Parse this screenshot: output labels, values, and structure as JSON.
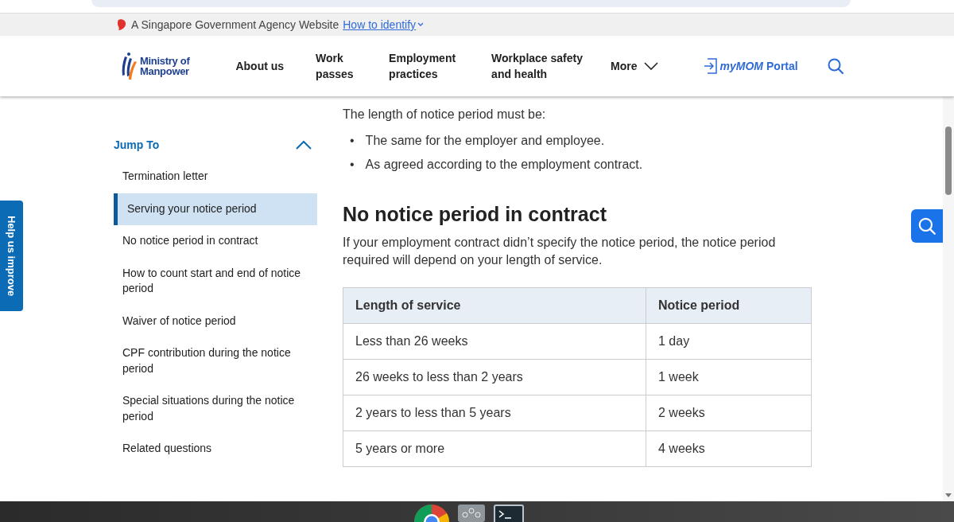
{
  "masthead": {
    "text": "A Singapore Government Agency Website",
    "link": "How to identify"
  },
  "header": {
    "logo": {
      "line_1": "Ministry of",
      "line_2": "Manpower"
    },
    "nav": [
      {
        "label": "About us",
        "kind": "link"
      },
      {
        "label": "Work passes",
        "kind": "link"
      },
      {
        "label": "Employment practices",
        "kind": "link"
      },
      {
        "label": "Workplace safety and health",
        "kind": "link"
      },
      {
        "label": "More",
        "kind": "dropdown"
      }
    ],
    "portal": {
      "brand": "myMOM",
      "label": "Portal"
    }
  },
  "feedback_tab": "Help us improve",
  "sidebar": {
    "title": "Jump To",
    "expanded": true,
    "items": [
      {
        "label": "Termination letter",
        "selected": false
      },
      {
        "label": "Serving your notice period",
        "selected": true
      },
      {
        "label": "No notice period in contract",
        "selected": false
      },
      {
        "label": "How to count start and end of notice period",
        "selected": false
      },
      {
        "label": "Waiver of notice period",
        "selected": false
      },
      {
        "label": "CPF contribution during the notice period",
        "selected": false
      },
      {
        "label": "Special situations during the notice period",
        "selected": false
      },
      {
        "label": "Related questions",
        "selected": false
      }
    ]
  },
  "article": {
    "intro": "The length of notice period must be:",
    "bullets": [
      {
        "marker": "•",
        "text": "The same for the employer and employee."
      },
      {
        "marker": "•",
        "text": "As agreed according to the employment contract."
      }
    ],
    "heading": "No notice period in contract",
    "paragraph": "If your employment contract didn’t specify the notice period, the notice period required will depend on your length of service.",
    "table": {
      "columns": [
        "Length of service",
        "Notice period"
      ],
      "rows": [
        [
          "Less than 26 weeks",
          "1 day"
        ],
        [
          "26 weeks to less than 2 years",
          "1 week"
        ],
        [
          "2 years to less than 5 years",
          "2 weeks"
        ],
        [
          "5 years or more",
          "4 weeks"
        ]
      ]
    }
  },
  "taskbar": {
    "apps": [
      {
        "kind": "browser"
      },
      {
        "kind": "network"
      },
      {
        "kind": "terminal"
      }
    ]
  }
}
